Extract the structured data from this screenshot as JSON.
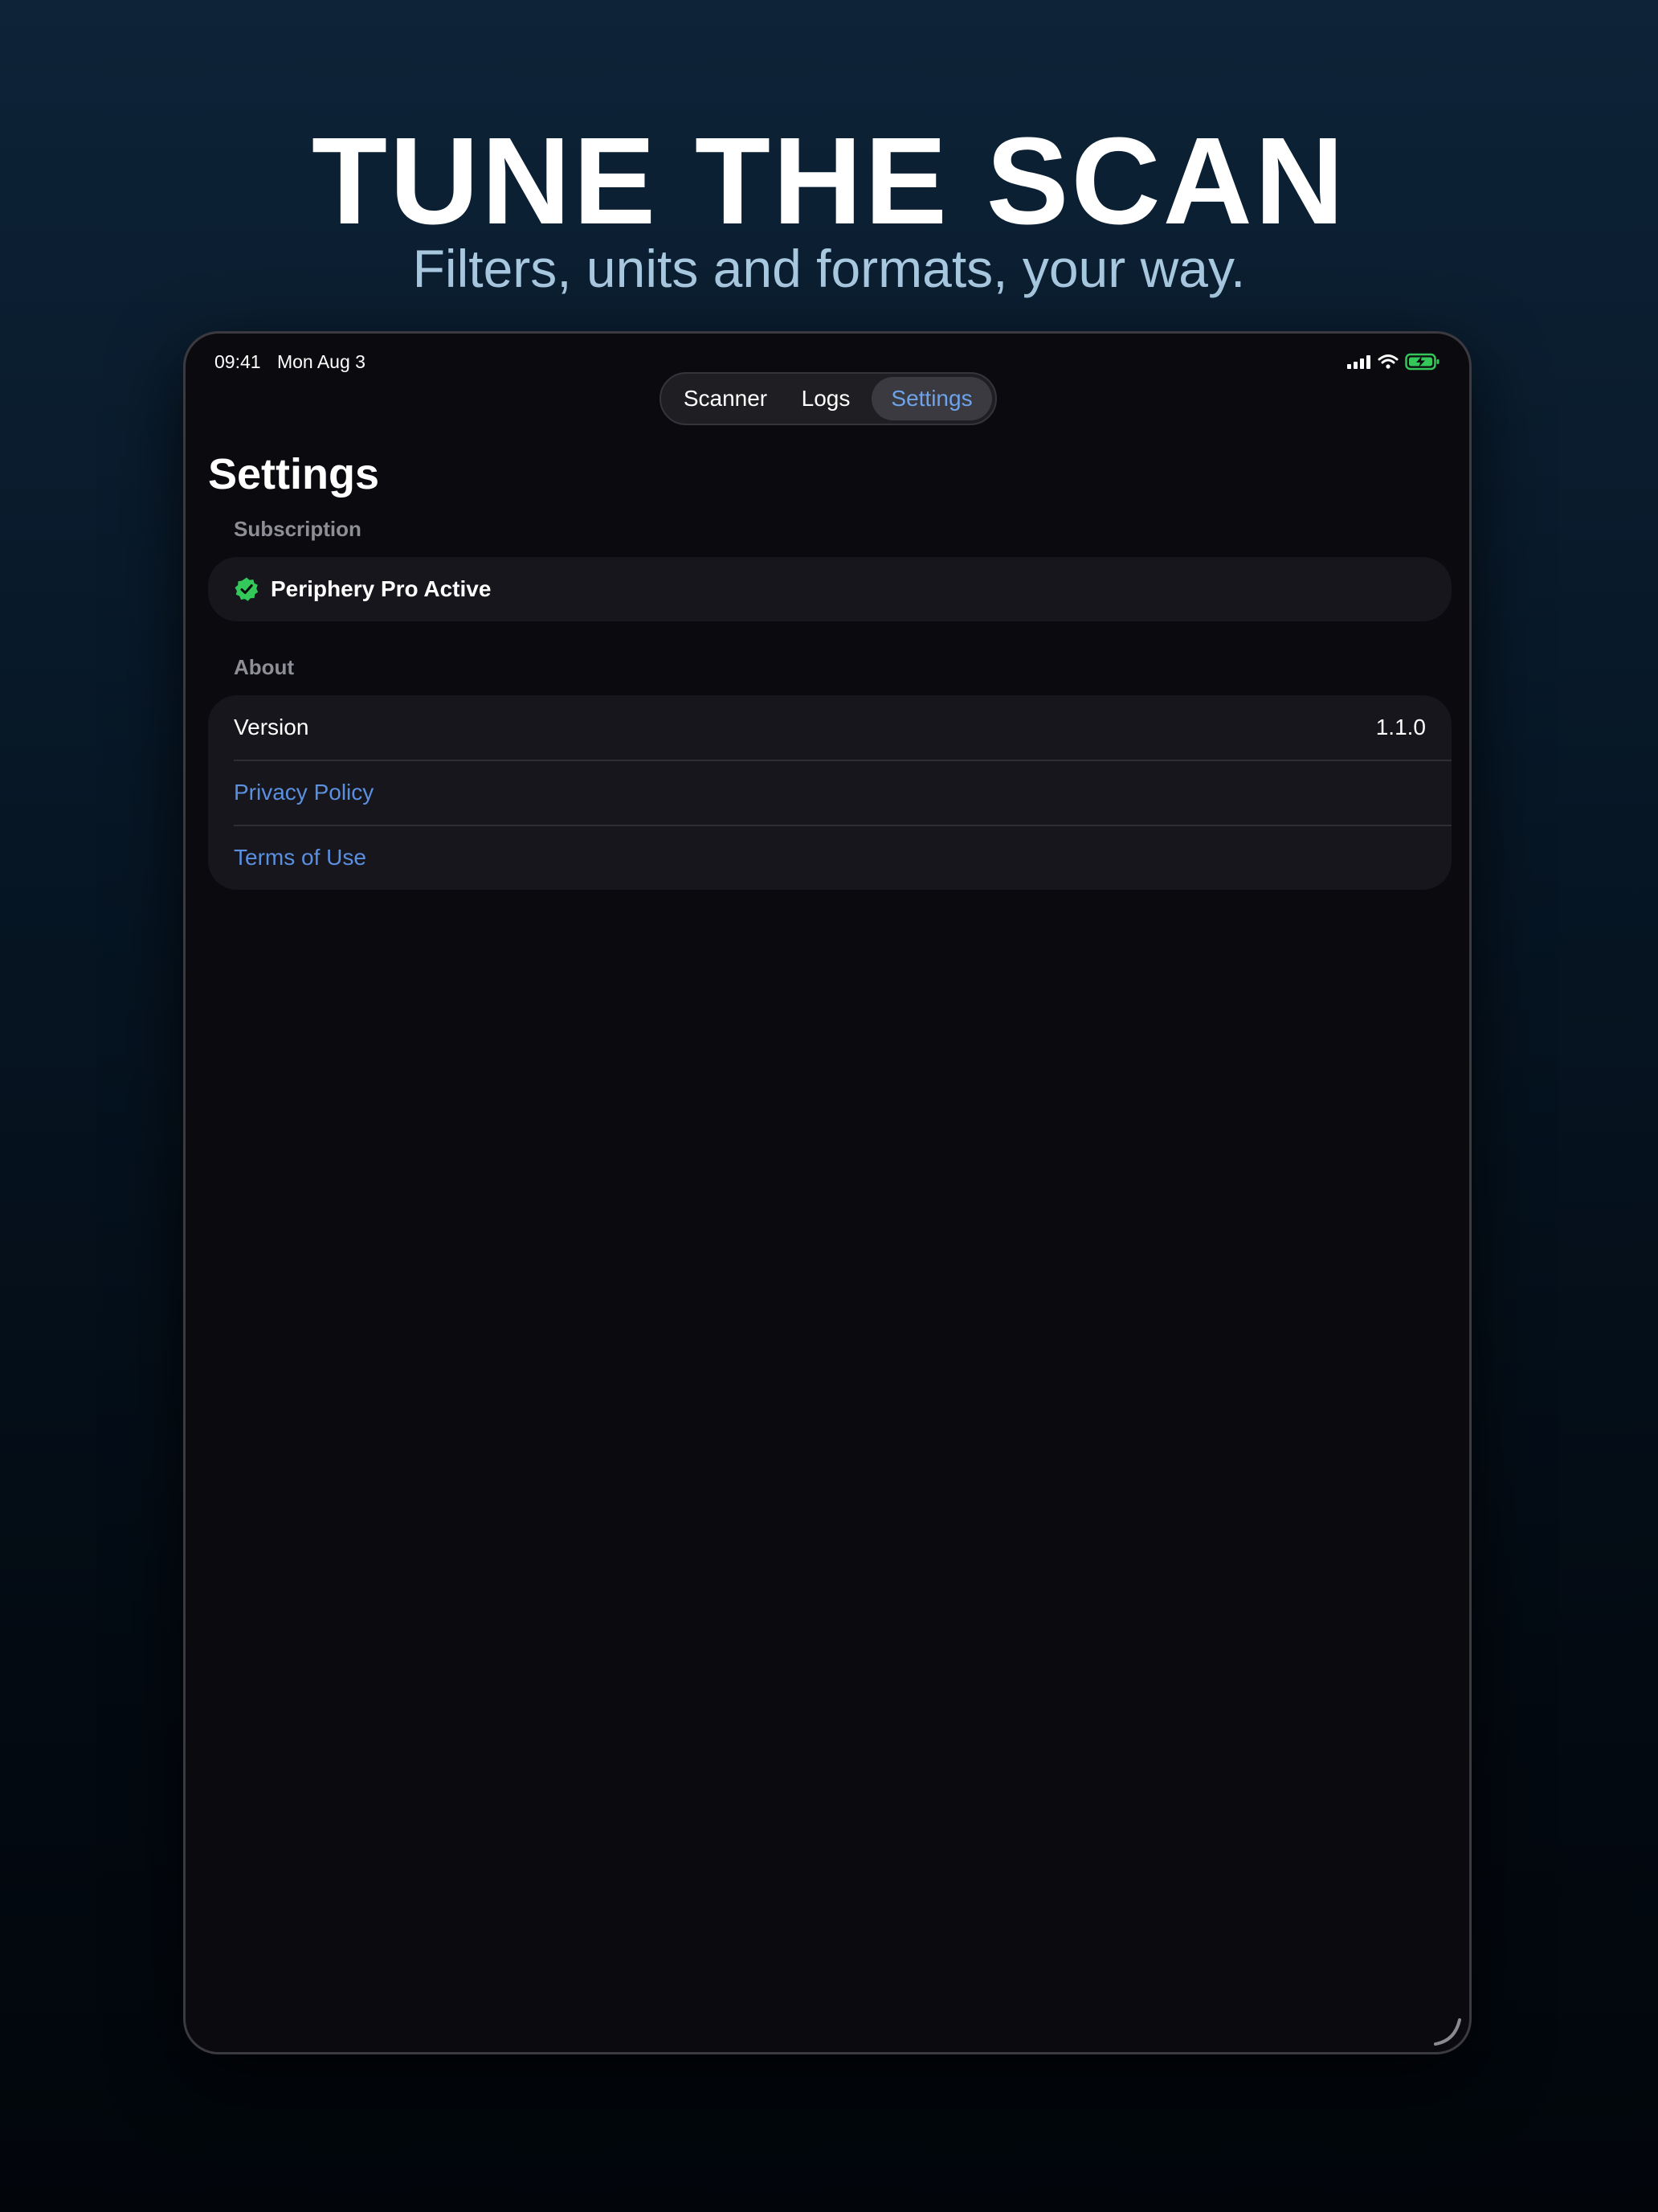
{
  "marketing": {
    "headline": "TUNE THE SCAN",
    "subheadline": "Filters, units and formats, your way."
  },
  "status_bar": {
    "time": "09:41",
    "date": "Mon Aug 3",
    "icons": [
      "cellular-signal-icon",
      "wifi-icon",
      "battery-charging-icon"
    ],
    "battery_color": "#34c759"
  },
  "tabs": [
    {
      "label": "Scanner",
      "selected": false
    },
    {
      "label": "Logs",
      "selected": false
    },
    {
      "label": "Settings",
      "selected": true
    }
  ],
  "page": {
    "title": "Settings"
  },
  "subscription": {
    "header": "Subscription",
    "status_label": "Periphery Pro Active",
    "status_icon": "checkmark-seal-icon",
    "status_color": "#34c759"
  },
  "about": {
    "header": "About",
    "version_label": "Version",
    "version_value": "1.1.0",
    "privacy_label": "Privacy Policy",
    "terms_label": "Terms of Use"
  },
  "colors": {
    "accent": "#6ea3ea",
    "link": "#5b8fdf",
    "background": "#0b0b0f"
  }
}
